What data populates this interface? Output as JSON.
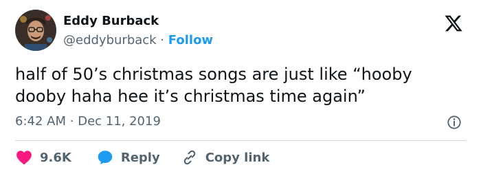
{
  "author": {
    "name": "Eddy Burback",
    "handle": "@eddyburback",
    "separator": "·",
    "follow_label": "Follow"
  },
  "tweet": {
    "text": "half of 50’s christmas songs are just like “hooby dooby haha hee it’s christmas time again”",
    "time": "6:42 AM",
    "separator": "·",
    "date": "Dec 11, 2019"
  },
  "actions": {
    "likes": "9.6K",
    "reply_label": "Reply",
    "copy_link_label": "Copy link"
  },
  "colors": {
    "accent": "#1d9bf0",
    "like": "#f91880",
    "text_primary": "#0f1419",
    "text_secondary": "#536471"
  },
  "icons": [
    "avatar",
    "x-logo-icon",
    "info-icon",
    "heart-icon",
    "reply-bubble-icon",
    "link-icon"
  ]
}
